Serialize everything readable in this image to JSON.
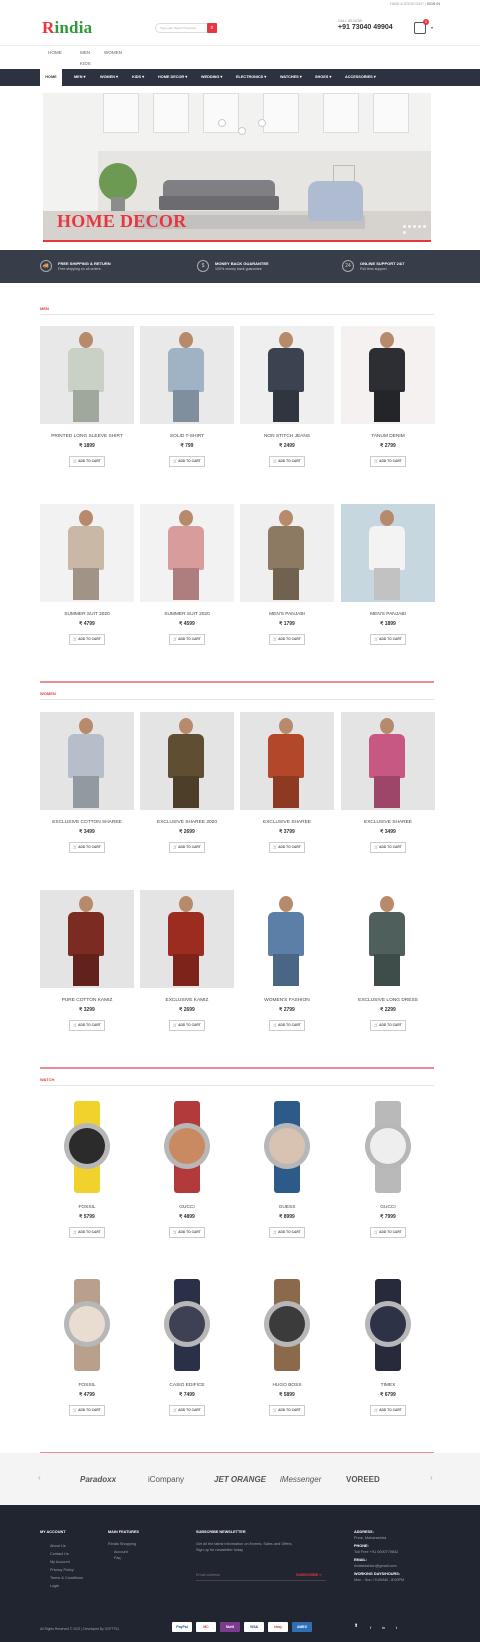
{
  "topbar": {
    "left": "HAVE A GOOD DAY!",
    "right": "SIGN IN"
  },
  "header": {
    "logo_r": "R",
    "logo_rest": "india",
    "search_placeholder": "Type your Search Keyword",
    "call_label": "CALL US NOW",
    "call_number": "+91 73040 49904"
  },
  "subnav": {
    "items": [
      "HOME",
      "MEN",
      "WOMEN",
      "KIDS"
    ]
  },
  "mainnav": {
    "items": [
      "HOME",
      "MEN ▾",
      "WOMEN ▾",
      "KIDS ▾",
      "HOME DECOR ▾",
      "WEDDING ▾",
      "ELECTRONICS ▾",
      "WATCHES ▾",
      "SHOES ▾",
      "ACCESSORIES ▾"
    ]
  },
  "banner": {
    "text": "HOME DECOR"
  },
  "features": [
    {
      "icon": "🚚",
      "title": "FREE SHIPPING & RETURN",
      "sub": "Free shipping on all orders."
    },
    {
      "icon": "$",
      "title": "MONEY BACK GUARANTEE",
      "sub": "100% money back guarantee"
    },
    {
      "icon": "24",
      "title": "ONLINE SUPPORT 24/7",
      "sub": "Full time support."
    }
  ],
  "sections": {
    "men": "MEN",
    "women": "WOMEN",
    "watch": "WATCH"
  },
  "add_to_cart": "ADD TO CART",
  "products": {
    "men": [
      {
        "name": "PRINTED LONG SLEEVE SHIRT",
        "price": "₹ 1899",
        "color": "#c8d1c4",
        "bg": "#e8e8e8"
      },
      {
        "name": "SOLID T-SHIRT",
        "price": "₹ 799",
        "color": "#9fb3c4",
        "bg": "#e9e9e9"
      },
      {
        "name": "NON STITCH JEANS",
        "price": "₹ 2499",
        "color": "#3c4350",
        "bg": "#efefef"
      },
      {
        "name": "TANUM DENIM",
        "price": "₹ 2799",
        "color": "#2c2e33",
        "bg": "#f6f1f1"
      },
      {
        "name": "SUMMER SUIT 2020",
        "price": "₹ 4799",
        "color": "#c9b8a6",
        "bg": "#f2f2f2"
      },
      {
        "name": "SUMMER SUIT 2020",
        "price": "₹ 4599",
        "color": "#d99c9c",
        "bg": "#f2f2f2"
      },
      {
        "name": "MEN'S PANJABI",
        "price": "₹ 1799",
        "color": "#8c7a62",
        "bg": "#efefef"
      },
      {
        "name": "MEN'S PANJABI",
        "price": "₹ 1899",
        "color": "#f3f3f3",
        "bg": "#c6d7e0"
      }
    ],
    "women": [
      {
        "name": "EXCLUSIVE COTTON SHAREE",
        "price": "₹ 3499",
        "color": "#b6bfc9",
        "bg": "#e4e4e4"
      },
      {
        "name": "EXCLUSIVE SHAREE 2020",
        "price": "₹ 2699",
        "color": "#5f4e32",
        "bg": "#e4e4e4"
      },
      {
        "name": "EXCLUSIVE SHAREE",
        "price": "₹ 3799",
        "color": "#b2472a",
        "bg": "#e4e4e4"
      },
      {
        "name": "EXCLUSIVE SHAREE",
        "price": "₹ 3499",
        "color": "#c65883",
        "bg": "#e4e4e4"
      },
      {
        "name": "PURE COTTON KAMIZ",
        "price": "₹ 3299",
        "color": "#7b2b22",
        "bg": "#e4e4e4"
      },
      {
        "name": "EXCLUSIVE KAMIZ",
        "price": "₹ 2699",
        "color": "#9c2c20",
        "bg": "#e4e4e4"
      },
      {
        "name": "WOMEN'S FASHION",
        "price": "₹ 2799",
        "color": "#5b7fa6",
        "bg": "#ffffff"
      },
      {
        "name": "EXCLUSIVE LONG DRESS",
        "price": "₹ 2299",
        "color": "#4e5f5c",
        "bg": "#ffffff"
      }
    ],
    "watch": [
      {
        "name": "FOSSIL",
        "price": "₹ 5799",
        "strap": "#f1d12b",
        "dial": "#2b2b2b",
        "bg": "#ffffff"
      },
      {
        "name": "GUCCI",
        "price": "₹ 4899",
        "strap": "#b33a3a",
        "dial": "#c98a62",
        "bg": "#ffffff"
      },
      {
        "name": "GUESS",
        "price": "₹ 8999",
        "strap": "#2c5b8a",
        "dial": "#d8c2b2",
        "bg": "#ffffff"
      },
      {
        "name": "GUCCI",
        "price": "₹ 7999",
        "strap": "#b9b9b9",
        "dial": "#eeeeee",
        "bg": "#ffffff"
      },
      {
        "name": "FOSSIL",
        "price": "₹ 4799",
        "strap": "#b9a08c",
        "dial": "#e9ddd2",
        "bg": "#ffffff"
      },
      {
        "name": "CASIO EDIFICE",
        "price": "₹ 7499",
        "strap": "#2a3048",
        "dial": "#3e4154",
        "bg": "#ffffff"
      },
      {
        "name": "HUGO BOSS",
        "price": "₹ 5899",
        "strap": "#8a6a4a",
        "dial": "#3b3b3b",
        "bg": "#ffffff"
      },
      {
        "name": "TIMEX",
        "price": "₹ 6799",
        "strap": "#262a3a",
        "dial": "#2e3246",
        "bg": "#ffffff"
      }
    ]
  },
  "brands": [
    "Paradoxx",
    "iCompany",
    "JET ORANGE",
    "iMessenger",
    "VOREED"
  ],
  "footer": {
    "account_title": "MY ACCOUNT",
    "account_items": [
      "About Us",
      "Contact Us",
      "My Account",
      "Privacy Policy",
      "Terms & Conditions",
      "Login"
    ],
    "features_title": "MAIN FEATURES",
    "features_items": [
      "Rindia Shopping",
      "Account",
      "Faq"
    ],
    "newsletter_title": "SUBSCRIBE NEWSLETTER",
    "newsletter_text": "Get all the latest information on Events, Sales and Offers. Sign up for newsletter today",
    "email_placeholder": "Email address",
    "subscribe": "SUBSCRIBE >",
    "address_title": "ADDRESS:",
    "address": "Pune, Maharashtra",
    "phone_title": "PHONE:",
    "phone": "Toll Free +91 0000779842",
    "email_title": "EMAIL:",
    "email": "rindiafashion@gmail.com",
    "hours_title": "WORKING DAYS/HOURS:",
    "hours": "Mon - Sun / 9:00AM - 8:00PM",
    "copyright": "All Rights Reserved © 2021 | Developed By SOFTTEL",
    "payments": [
      "PayPal",
      "MC",
      "Skrill",
      "VISA",
      "ebay",
      "AMEX"
    ],
    "social": [
      "f",
      "in",
      "t"
    ]
  },
  "colors": {
    "accent": "#e8363f",
    "nav": "#2d3240",
    "footer": "#20252f",
    "logo_green": "#2f9a3a"
  }
}
